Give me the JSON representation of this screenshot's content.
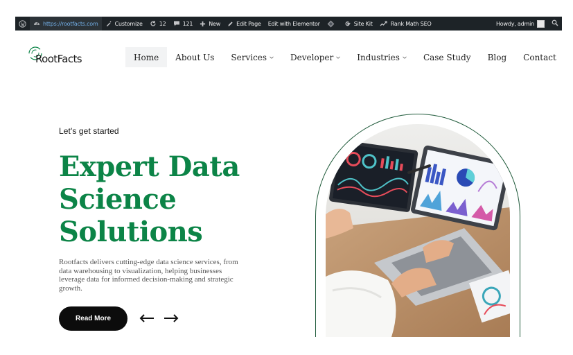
{
  "adminbar": {
    "url": "https://rootfacts.com",
    "customize": "Customize",
    "updates_count": "12",
    "comments_count": "121",
    "new_label": "New",
    "edit_page": "Edit Page",
    "edit_elementor": "Edit with Elementor",
    "site_kit": "Site Kit",
    "rank_math": "Rank Math SEO",
    "howdy": "Howdy, admin"
  },
  "logo": {
    "text": "RootFacts"
  },
  "nav": {
    "items": [
      {
        "label": "Home",
        "active": true
      },
      {
        "label": "About Us"
      },
      {
        "label": "Services",
        "dropdown": true
      },
      {
        "label": "Developer",
        "dropdown": true
      },
      {
        "label": "Industries",
        "dropdown": true
      },
      {
        "label": "Case Study"
      },
      {
        "label": "Blog"
      },
      {
        "label": "Contact"
      }
    ]
  },
  "hero": {
    "eyebrow": "Let's get started",
    "title_line1": "Expert Data",
    "title_line2": "Science",
    "title_line3": "Solutions",
    "description": "Rootfacts delivers cutting-edge data science services, from data warehousing to visualization, helping businesses leverage data for informed decision-making and strategic growth.",
    "button": "Read More"
  },
  "colors": {
    "brand_green": "#0c8447",
    "admin_bar": "#1d2327",
    "button_bg": "#0c0c0c"
  }
}
